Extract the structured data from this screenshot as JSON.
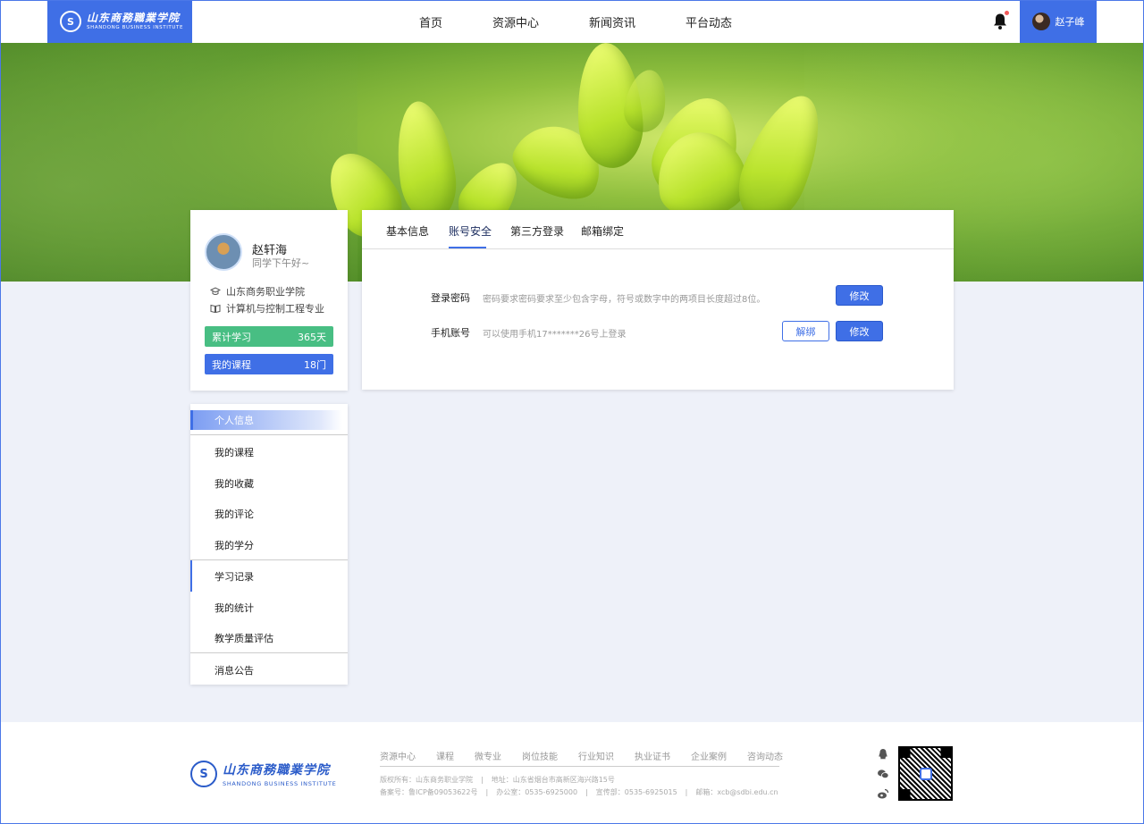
{
  "header": {
    "logo_cn": "山东商務職業学院",
    "logo_en": "SHANDONG BUSINESS INSTITUTE",
    "logo_seal": "S",
    "nav": [
      "首页",
      "资源中心",
      "新闻资讯",
      "平台动态"
    ],
    "user_name": "赵子峰"
  },
  "profile": {
    "name": "赵轩海",
    "greeting": "同学下午好~",
    "school": "山东商务职业学院",
    "major": "计算机与控制工程专业",
    "stats": [
      {
        "label": "累计学习",
        "value": "365天"
      },
      {
        "label": "我的课程",
        "value": "18门"
      }
    ]
  },
  "menu": {
    "items": [
      "个人信息",
      "我的课程",
      "我的收藏",
      "我的评论",
      "我的学分",
      "学习记录",
      "我的统计",
      "教学质量评估",
      "消息公告"
    ]
  },
  "panel": {
    "tabs": [
      "基本信息",
      "账号安全",
      "第三方登录",
      "邮箱绑定"
    ],
    "active_tab": "账号安全",
    "fields": [
      {
        "label": "登录密码",
        "desc": "密码要求密码要求至少包含字母，符号或数字中的两项目长度超过8位。",
        "buttons": [
          "修改"
        ]
      },
      {
        "label": "手机账号",
        "desc": "可以使用手机17*******26号上登录",
        "buttons": [
          "解绑",
          "修改"
        ]
      }
    ]
  },
  "footer": {
    "links": [
      "资源中心",
      "课程",
      "微专业",
      "岗位技能",
      "行业知识",
      "执业证书",
      "企业案例",
      "咨询动态"
    ],
    "row1": [
      "版权所有：山东商务职业学院",
      "地址：山东省烟台市高新区海兴路15号"
    ],
    "row2": [
      "备案号：鲁ICP备09053622号",
      "办公室：0535-6925000",
      "宣传部：0535-6925015",
      "邮箱：xcb@sdbi.edu.cn"
    ],
    "info_sep": "|"
  },
  "colors": {
    "primary": "#3f6fe6",
    "green": "#48be83",
    "page_bg": "#eef1f9",
    "notify_dot": "#f25a5a"
  }
}
